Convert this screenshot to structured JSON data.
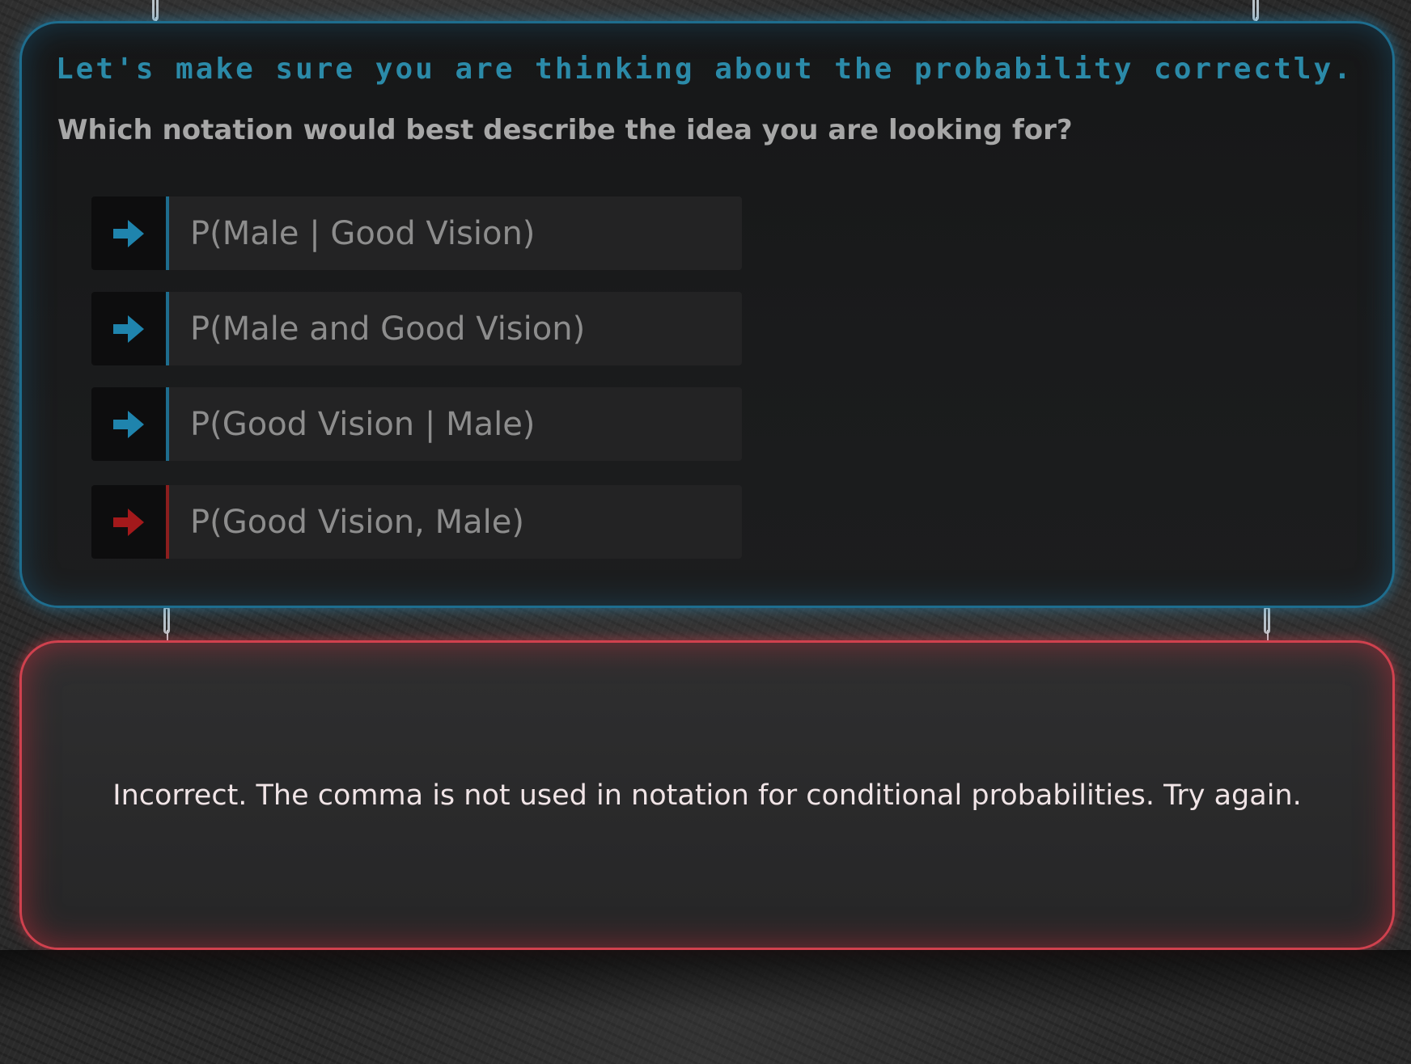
{
  "question": {
    "prompt": "Let's make sure you are thinking about the probability correctly.",
    "subtitle": "Which notation would best describe the idea you are looking for?"
  },
  "options": [
    {
      "label": "P(Male | Good Vision)",
      "state": "default",
      "arrow_color": "#1f84ad"
    },
    {
      "label": "P(Male and Good Vision)",
      "state": "default",
      "arrow_color": "#1f84ad"
    },
    {
      "label": "P(Good Vision | Male)",
      "state": "default",
      "arrow_color": "#1f84ad"
    },
    {
      "label": "P(Good Vision, Male)",
      "state": "selected-incorrect",
      "arrow_color": "#a3191b"
    }
  ],
  "feedback": {
    "text": "Incorrect. The comma is not used in notation for conditional probabilities. Try again.",
    "status": "incorrect"
  },
  "colors": {
    "question_border": "#1e6d8e",
    "prompt_text": "#2b8aa8",
    "feedback_border": "#d0414e",
    "incorrect_accent": "#8c1e1e"
  },
  "icons": {
    "option_arrow": "arrow-right-icon",
    "hanger": "chain-hook-icon"
  }
}
